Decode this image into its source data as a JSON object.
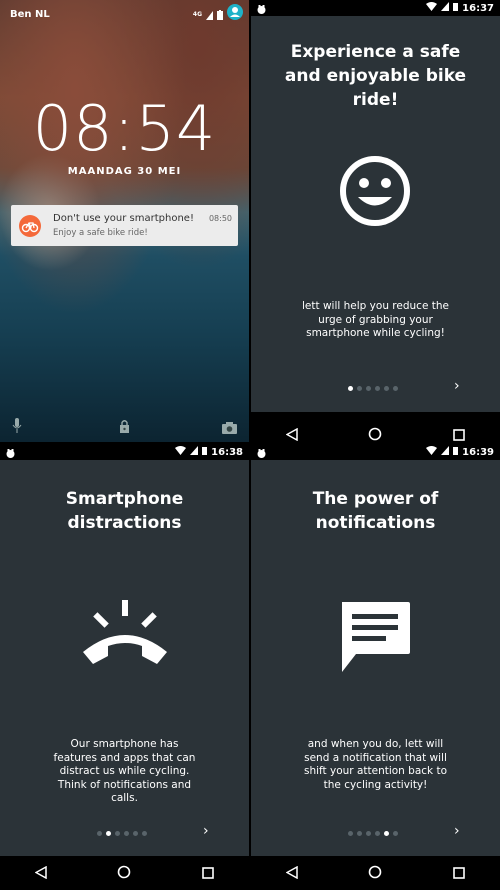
{
  "lockscreen": {
    "carrier": "Ben NL",
    "network": "4G",
    "time": "08:54",
    "date": "MAANDAG 30 MEI",
    "notification": {
      "title": "Don't use your smartphone!",
      "subtitle": "Enjoy a safe bike ride!",
      "time": "08:50",
      "icon": "bicycle-icon",
      "color": "#f4693a"
    },
    "bottom_icons": [
      "microphone-icon",
      "lock-icon",
      "camera-icon"
    ]
  },
  "screens": [
    {
      "status_time": "16:37",
      "title": "Experience a safe and enjoyable bike ride!",
      "icon": "smiley-icon",
      "body": "lett will help you reduce the urge of grabbing your smartphone while cycling!",
      "active_dot": 0
    },
    {
      "status_time": "16:38",
      "title": "Smartphone distractions",
      "icon": "ringing-phone-icon",
      "body": "Our smartphone has features and apps that can distract us while cycling. Think of notifications and calls.",
      "active_dot": 1
    },
    {
      "status_time": "16:39",
      "title": "The power of notifications",
      "icon": "message-icon",
      "body": "and when you do, lett will send a notification that will shift your attention back to the cycling activity!",
      "active_dot": 4
    }
  ],
  "dot_count": 6,
  "next_label": "›",
  "colors": {
    "background": "#2b3338",
    "accent": "#f4693a",
    "dot_inactive": "#59646a"
  }
}
